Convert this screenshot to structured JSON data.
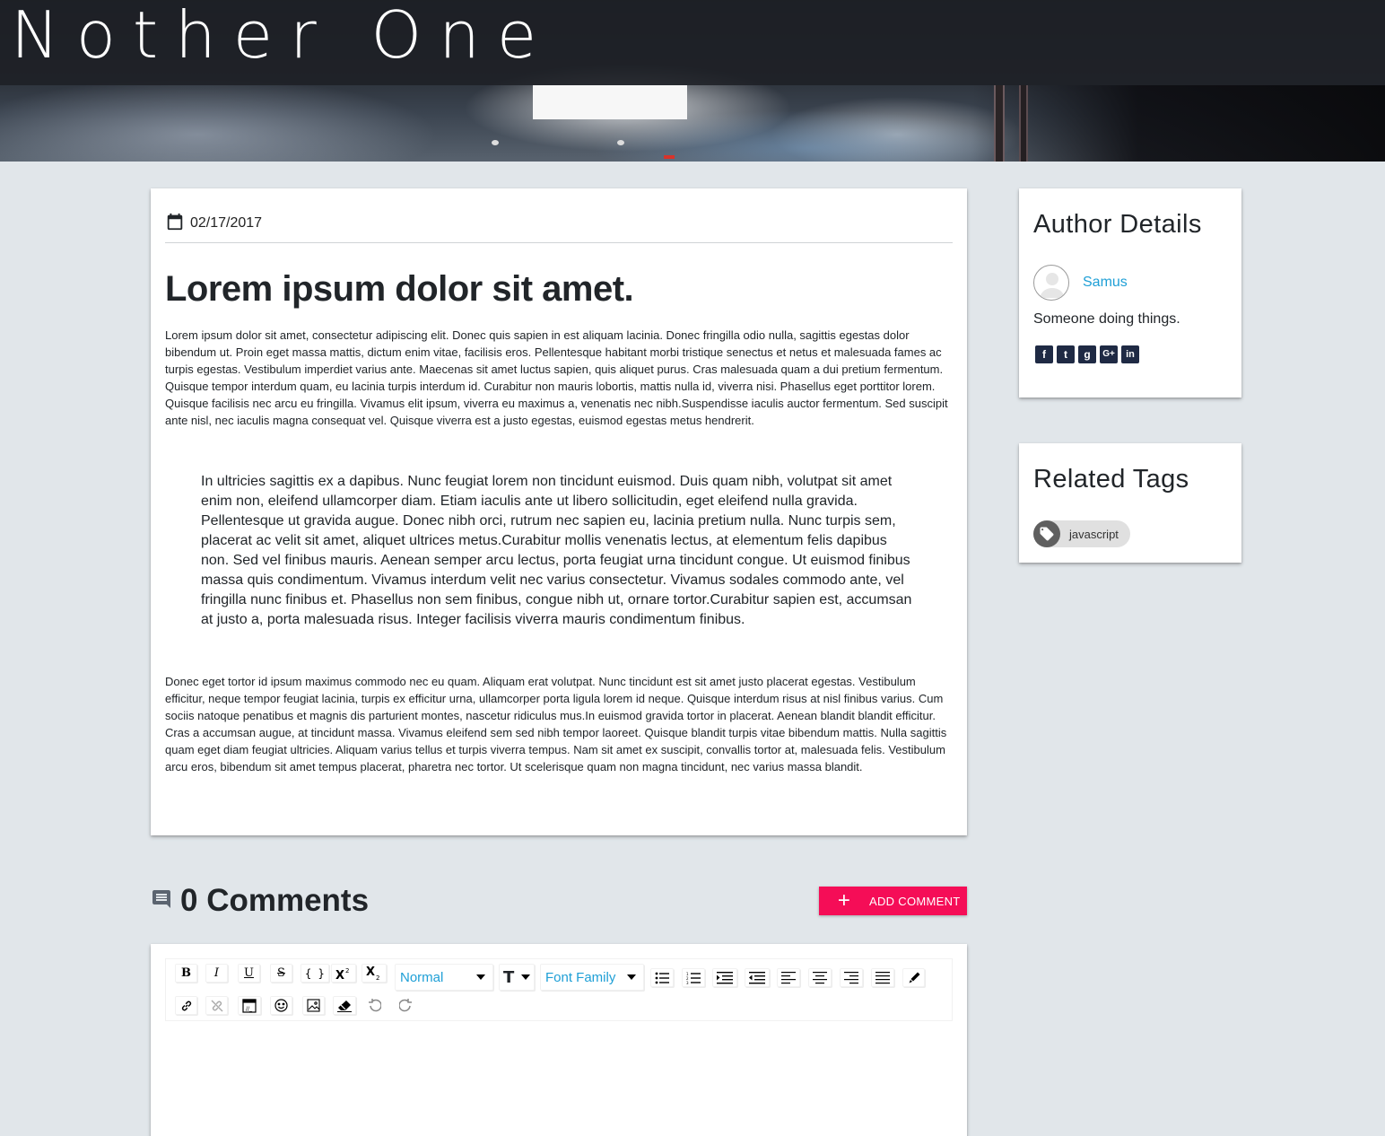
{
  "site": {
    "title": "Nother One"
  },
  "post": {
    "date": "02/17/2017",
    "title": "Lorem ipsum dolor sit amet.",
    "paragraph1": "Lorem ipsum dolor sit amet, consectetur adipiscing elit. Donec quis sapien in est aliquam lacinia. Donec fringilla odio nulla, sagittis egestas dolor bibendum ut. Proin eget massa mattis, dictum enim vitae, facilisis eros. Pellentesque habitant morbi tristique senectus et netus et malesuada fames ac turpis egestas. Vestibulum imperdiet varius ante. Maecenas sit amet luctus sapien, quis aliquet purus. Cras malesuada quam a dui pretium fermentum. Quisque tempor interdum quam, eu lacinia turpis interdum id. Curabitur non mauris lobortis, mattis nulla id, viverra nisi. Phasellus eget porttitor lorem. Quisque facilisis nec arcu eu fringilla. Vivamus elit ipsum, viverra eu maximus a, venenatis nec nibh.Suspendisse iaculis auctor fermentum. Sed suscipit ante nisl, nec iaculis magna consequat vel. Quisque viverra est a justo egestas, euismod egestas metus hendrerit.",
    "blockquote": " In ultricies sagittis ex a dapibus. Nunc feugiat lorem non tincidunt euismod. Duis quam nibh, volutpat sit amet enim non, eleifend ullamcorper diam. Etiam iaculis ante ut libero sollicitudin, eget eleifend nulla gravida. Pellentesque ut gravida augue. Donec nibh orci, rutrum nec sapien eu, lacinia pretium nulla. Nunc turpis sem, placerat ac velit sit amet, aliquet ultrices metus.Curabitur mollis venenatis lectus, at elementum felis dapibus non. Sed vel finibus mauris. Aenean semper arcu lectus, porta feugiat urna tincidunt congue. Ut euismod finibus massa quis condimentum. Vivamus interdum velit nec varius consectetur. Vivamus sodales commodo ante, vel fringilla nunc finibus et. Phasellus non sem finibus, congue nibh ut, ornare tortor.Curabitur sapien est, accumsan at justo a, porta malesuada risus. Integer facilisis viverra mauris condimentum finibus.",
    "paragraph2": " Donec eget tortor id ipsum maximus commodo nec eu quam. Aliquam erat volutpat. Nunc tincidunt est sit amet justo placerat egestas. Vestibulum efficitur, neque tempor feugiat lacinia, turpis ex efficitur urna, ullamcorper porta ligula lorem id neque. Quisque interdum risus at nisl finibus varius. Cum sociis natoque penatibus et magnis dis parturient montes, nascetur ridiculus mus.In euismod gravida tortor in placerat. Aenean blandit blandit efficitur. Cras a accumsan augue, at tincidunt massa. Vivamus eleifend sem sed nibh tempor laoreet. Quisque blandit turpis vitae bibendum mattis. Nulla sagittis quam eget diam feugiat ultricies. Aliquam varius tellus et turpis viverra tempus. Nam sit amet ex suscipit, convallis tortor at, malesuada felis. Vestibulum arcu eros, bibendum sit amet tempus placerat, pharetra nec tortor. Ut scelerisque quam non magna tincidunt, nec varius massa blandit."
  },
  "author": {
    "heading": "Author Details",
    "name": "Samus",
    "bio": "Someone doing things.",
    "social": [
      {
        "icon": "facebook-icon",
        "glyph": "f"
      },
      {
        "icon": "twitter-icon",
        "glyph": "t"
      },
      {
        "icon": "github-icon",
        "glyph": "g"
      },
      {
        "icon": "google-plus-icon",
        "glyph": "G+"
      },
      {
        "icon": "linkedin-icon",
        "glyph": "in"
      }
    ]
  },
  "tags": {
    "heading": "Related Tags",
    "items": [
      "javascript"
    ]
  },
  "comments": {
    "count_label": "0 Comments",
    "add_button": "ADD COMMENT"
  },
  "editor": {
    "block_type": "Normal",
    "font_family": "Font Family",
    "font_size_glyph": "T",
    "buttons_row1": [
      "bold",
      "italic",
      "underline",
      "strikethrough",
      "monospace",
      "superscript",
      "subscript"
    ],
    "buttons_row1_right": [
      "unordered-list",
      "ordered-list",
      "indent",
      "outdent",
      "align-left",
      "align-center",
      "align-right",
      "align-justify",
      "color-picker"
    ],
    "buttons_row2": [
      "link",
      "unlink",
      "embedded",
      "emoji",
      "image",
      "remove-formatting",
      "undo",
      "redo"
    ]
  },
  "colors": {
    "accent": "#f50d57",
    "link": "#1e9fd6",
    "background": "#e1e6ea",
    "social": "#1f2a44"
  }
}
